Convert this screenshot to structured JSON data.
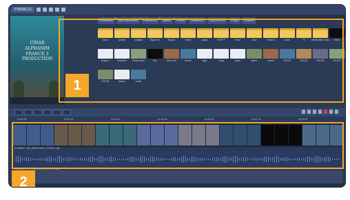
{
  "app": {
    "logo": "PINNACLE",
    "path": "Documents and Settings\\Media\\My Documents\\Media\\Studio Projects"
  },
  "preview": {
    "line1": "CINAR",
    "line2": "ALPHANIM",
    "line3": "FRANCE 3 PRODUCTION"
  },
  "folder_tabs": [
    "Animations",
    "Mes documents",
    "Extensions",
    "Videos",
    "Photos",
    "Transitions",
    "Sons et titres",
    "Fonds",
    "Modeles"
  ],
  "media": [
    {
      "label": "anim",
      "kind": "folder"
    },
    {
      "label": "sprites",
      "kind": "folder"
    },
    {
      "label": "Images",
      "kind": "folder"
    },
    {
      "label": "Bignell A",
      "kind": "folder"
    },
    {
      "label": "Studio",
      "kind": "folder"
    },
    {
      "label": "Travel",
      "kind": "folder"
    },
    {
      "label": "plans",
      "kind": "folder"
    },
    {
      "label": "PORTF",
      "kind": "folder"
    },
    {
      "label": "Fleur",
      "kind": "folder"
    },
    {
      "label": "Jeux",
      "kind": "folder"
    },
    {
      "label": "Travel 2",
      "kind": "folder"
    },
    {
      "label": "autre",
      "kind": "folder"
    },
    {
      "label": "TV",
      "kind": "folder"
    },
    {
      "label": "Fabrication video",
      "kind": "folder"
    },
    {
      "label": "video",
      "kind": "dark"
    },
    {
      "label": "image 1",
      "kind": "doc"
    },
    {
      "label": "Bouteille",
      "kind": "doc"
    },
    {
      "label": "Paris canal",
      "kind": "photo"
    },
    {
      "label": "Noir",
      "kind": "dark"
    },
    {
      "label": "film pont",
      "kind": "photo"
    },
    {
      "label": "Nemo",
      "kind": "photo"
    },
    {
      "label": "logo",
      "kind": "doc"
    },
    {
      "label": "rouge",
      "kind": "doc"
    },
    {
      "label": "blanc",
      "kind": "doc"
    },
    {
      "label": "jaune",
      "kind": "photo"
    },
    {
      "label": "scene",
      "kind": "photo"
    },
    {
      "label": "DSC01",
      "kind": "photo"
    },
    {
      "label": "DSC02",
      "kind": "photo"
    },
    {
      "label": "DSC03",
      "kind": "photo"
    },
    {
      "label": "DSC04",
      "kind": "photo"
    },
    {
      "label": "DSC05",
      "kind": "photo"
    },
    {
      "label": "beaux",
      "kind": "doc"
    },
    {
      "label": "rehab",
      "kind": "photo"
    }
  ],
  "badges": {
    "one": "1",
    "two": "2"
  },
  "ruler": [
    "00:00:00",
    "00:01:30",
    "00:03:00",
    "00:04:30",
    "00:06:00",
    "00:07:30",
    "00:09:00"
  ],
  "tracks": {
    "video": "CLASSIC TVE_00020 MOV_TUTSH 1.avi",
    "audio": "CLASSIC TVE_00020 MOV_TUTSH 1.avi"
  }
}
